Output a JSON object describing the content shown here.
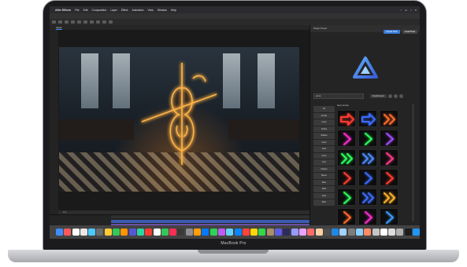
{
  "device": {
    "label": "MacBook Pro"
  },
  "menubar": {
    "app_name": "After Effects",
    "items": [
      "File",
      "Edit",
      "Composition",
      "Layer",
      "Effect",
      "Animation",
      "View",
      "Window",
      "Help"
    ]
  },
  "composition": {
    "tab_label": "Layer",
    "viewer_status": "Full"
  },
  "panel": {
    "title": "Plugin Panel",
    "buttons": [
      "Upload Pack",
      "Install Pack"
    ],
    "search_placeholder": "arrow",
    "dashboard_button": "Dashboard",
    "grid_title": "Neon Arrows",
    "categories": [
      "All",
      "Arrows",
      "Lines",
      "Circles",
      "Shapes",
      "Neon",
      "Glow",
      "Icons",
      "Text",
      "Frames",
      "Boxes",
      "Bars",
      "Stars",
      "Dots",
      "Misc"
    ]
  },
  "colors": {
    "accent": "#3a7bd5",
    "neon_red": "#ff3b30",
    "neon_blue": "#3b6cff",
    "neon_orange": "#ff6a2b",
    "neon_green": "#2bff5b",
    "neon_purple": "#a44bff"
  },
  "thumbnails": [
    {
      "icon": "arrow-right-outline-icon",
      "color": "#ff3b30"
    },
    {
      "icon": "arrow-right-outline-icon",
      "color": "#3b6cff"
    },
    {
      "icon": "chevron-double-icon",
      "color": "#ff6a2b"
    },
    {
      "icon": "chevron-icon",
      "color": "#ff2bd0"
    },
    {
      "icon": "chevron-icon",
      "color": "#2bff5b"
    },
    {
      "icon": "chevron-icon",
      "color": "#a44bff"
    },
    {
      "icon": "chevron-double-icon",
      "color": "#2bff5b"
    },
    {
      "icon": "chevron-double-icon",
      "color": "#4a8cff"
    },
    {
      "icon": "chevron-icon",
      "color": "#ff3b8a"
    },
    {
      "icon": "chevron-icon",
      "color": "#ff3b30"
    },
    {
      "icon": "chevron-icon",
      "color": "#3b6cff"
    },
    {
      "icon": "chevron-icon",
      "color": "#ff3b30"
    },
    {
      "icon": "chevron-icon",
      "color": "#2bff5b"
    },
    {
      "icon": "chevron-double-icon",
      "color": "#3b6cff"
    },
    {
      "icon": "chevron-double-icon",
      "color": "#ffb02b"
    },
    {
      "icon": "chevron-icon",
      "color": "#ff6a2b"
    },
    {
      "icon": "chevron-icon",
      "color": "#ff2bd0"
    },
    {
      "icon": "chevron-icon",
      "color": "#3b9cff"
    }
  ],
  "dock_colors": [
    "#3f8cff",
    "#ff5a5a",
    "#ffffff",
    "#e8e8e8",
    "#4ac9ff",
    "#6b6b6b",
    "#ffcc33",
    "#34c759",
    "#ff9500",
    "#5856d6",
    "#2bd4a5",
    "#ff3b30",
    "#ffffff",
    "#34c759",
    "#ff2d55",
    "#3a3a3a",
    "#8e8e93",
    "#ff9f0a",
    "#007aff",
    "#30d158",
    "#bf5af2",
    "#64d2ff",
    "#0a84ff",
    "#ff453a",
    "#ffd60a",
    "#32d74b",
    "#ac8e68",
    "#5e5ce6",
    "#2b2b5e",
    "#9999ff",
    "#e8a3ff",
    "#ff6b6b",
    "#ffd1a4",
    "#4d4d4d",
    "#1e88e5",
    "#a2d2ff",
    "#7d7d7d",
    "#8ad0ff",
    "#ff8a65",
    "#c5c5c5",
    "#ffffff",
    "#dddddd",
    "#b0b0b0",
    "#1c1c1c",
    "#2196f3",
    "#6f6f6f"
  ]
}
